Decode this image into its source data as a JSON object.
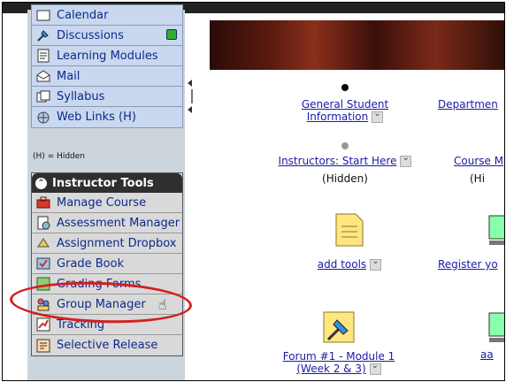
{
  "sidebar": {
    "nav_items": [
      {
        "label": "Calendar",
        "icon": "calendar-icon"
      },
      {
        "label": "Discussions",
        "icon": "pushpin-icon"
      },
      {
        "label": "Learning Modules",
        "icon": "document-icon"
      },
      {
        "label": "Mail",
        "icon": "mail-icon"
      },
      {
        "label": "Syllabus",
        "icon": "syllabus-icon"
      },
      {
        "label": "Web Links (H)",
        "icon": "globe-icon"
      }
    ],
    "hidden_note": "(H) = Hidden",
    "instructor_tools": {
      "title": "Instructor Tools",
      "items": [
        {
          "label": "Manage Course",
          "icon": "toolbox-icon"
        },
        {
          "label": "Assessment Manager",
          "icon": "assessment-icon"
        },
        {
          "label": "Assignment Dropbox",
          "icon": "dropbox-icon"
        },
        {
          "label": "Grade Book",
          "icon": "gradebook-icon"
        },
        {
          "label": "Grading Forms",
          "icon": "grading-forms-icon"
        },
        {
          "label": "Group Manager",
          "icon": "group-icon"
        },
        {
          "label": "Tracking",
          "icon": "chart-icon"
        },
        {
          "label": "Selective Release",
          "icon": "release-icon"
        }
      ]
    }
  },
  "main": {
    "items": [
      {
        "line1": "General Student",
        "line2": "Information"
      },
      {
        "line1": "Departmen"
      },
      {
        "line1": "Instructors: Start Here",
        "status": "(Hidden)"
      },
      {
        "line1": "Course M",
        "status": "(Hi"
      },
      {
        "line1": "add  tools"
      },
      {
        "line1": "Register yo"
      },
      {
        "line1": "Forum #1 - Module 1",
        "line2": "(Week 2 & 3)"
      },
      {
        "line1": "aa"
      }
    ]
  },
  "colors": {
    "link": "#1a1aa6",
    "highlight_circle": "#d31f1f"
  }
}
